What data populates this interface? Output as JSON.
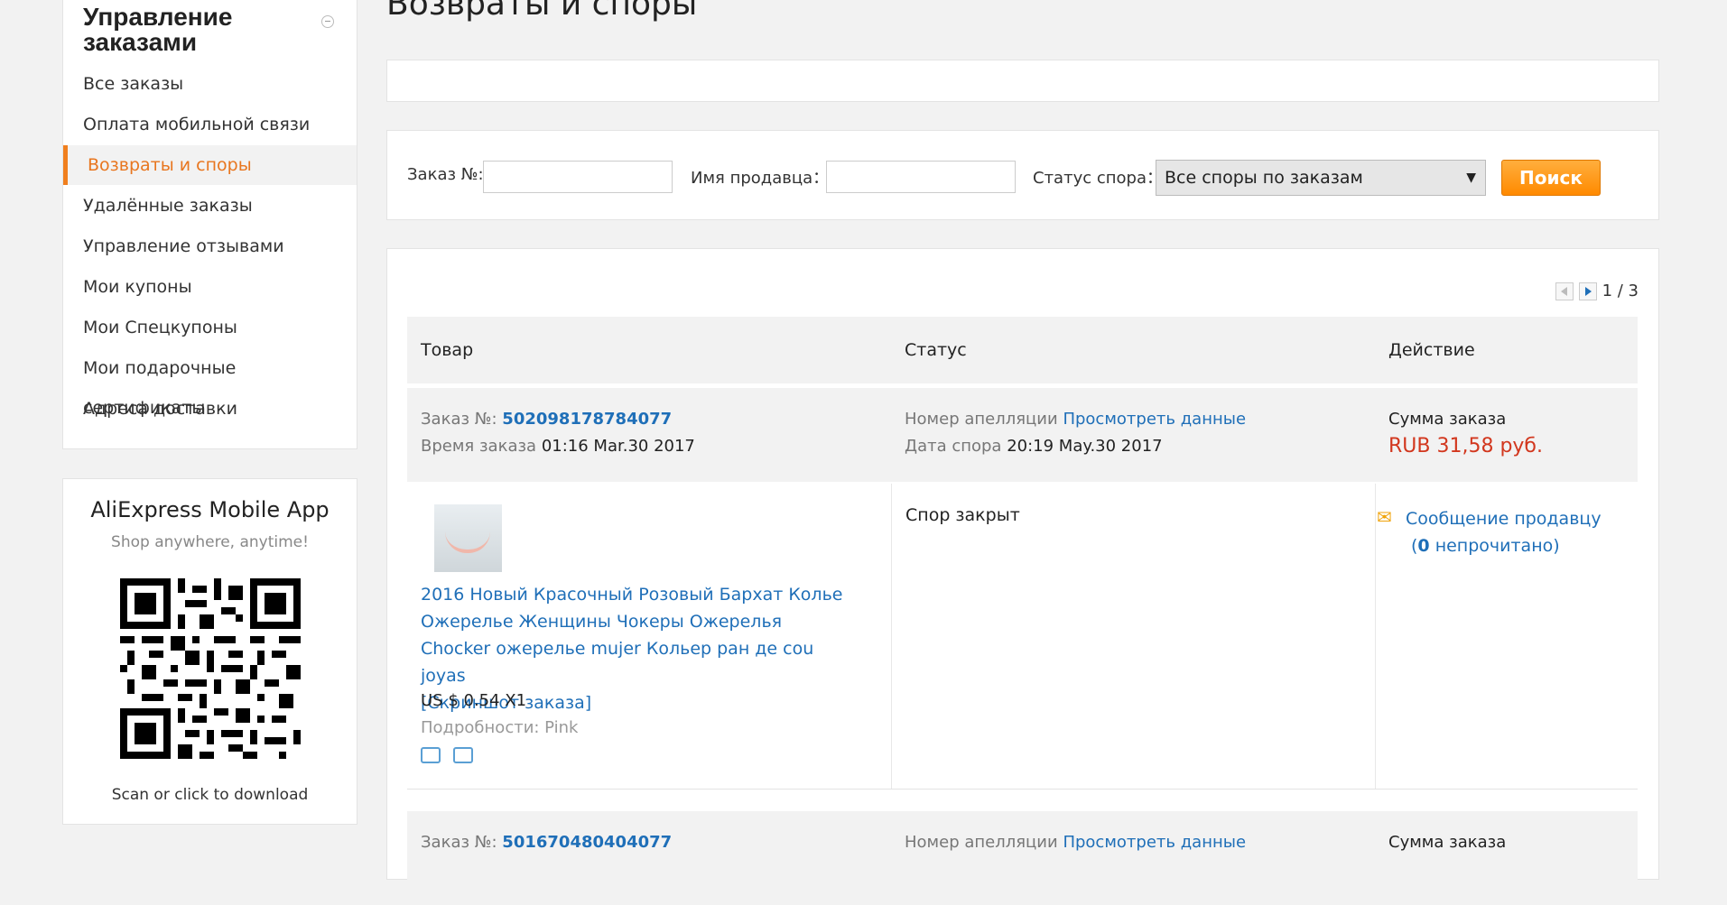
{
  "sidebar": {
    "title": "Управление заказами",
    "items": [
      {
        "label": "Все заказы"
      },
      {
        "label": "Оплата мобильной связи"
      },
      {
        "label": "Возвраты и споры"
      },
      {
        "label": "Удалённые заказы"
      },
      {
        "label": "Управление отзывами"
      },
      {
        "label": "Мои купоны"
      },
      {
        "label": "Мои Спецкупоны"
      },
      {
        "label": "Мои подарочные сертификаты"
      },
      {
        "label": "Адреса доставки"
      }
    ],
    "active_index": 2
  },
  "app_promo": {
    "title": "AliExpress Mobile App",
    "subtitle": "Shop anywhere, anytime!",
    "download_text": "Scan or click to download"
  },
  "page": {
    "title": "Возвраты и споры"
  },
  "filter": {
    "order_label": "Заказ №:",
    "order_value": "",
    "seller_label": "Имя продавца：",
    "seller_value": "",
    "status_label": "Статус спора：",
    "status_selected": "Все споры по заказам",
    "search_button": "Поиск"
  },
  "pager": {
    "text": "1 / 3"
  },
  "table": {
    "headers": [
      "Товар",
      "Статус",
      "Действие"
    ]
  },
  "orders": [
    {
      "order_label": "Заказ №:",
      "order_number": "502098178784077",
      "time_label": "Время заказа",
      "time_value": "01:16 Mar.30 2017",
      "appeal_label": "Номер апелляции",
      "appeal_link": "Просмотреть данные",
      "dispute_date_label": "Дата спора",
      "dispute_date_value": "20:19 May.30 2017",
      "sum_label": "Сумма заказа",
      "sum_value": "RUB 31,58 руб.",
      "product_title": "2016 Новый Красочный Розовый Бархат Колье Ожерелье Женщины Чокеры Ожерелья Chocker ожерелье mujer Кольер ран де cou joyas",
      "snapshot": "[Скриншот заказа]",
      "price": "US $ 0.54 X1",
      "details": "Подробности: Pink",
      "status": "Спор закрыт",
      "message_link": "Сообщение продавцу",
      "unread_prefix": "(",
      "unread_count": "0",
      "unread_suffix": " непрочитано)"
    },
    {
      "order_label": "Заказ №:",
      "order_number": "501670480404077",
      "appeal_label": "Номер апелляции",
      "appeal_link": "Просмотреть данные",
      "sum_label": "Сумма заказа"
    }
  ],
  "icons": {
    "collapse": "minus-circle-icon",
    "message": "envelope-icon",
    "truck": "truck-icon",
    "return": "return-icon"
  },
  "colors": {
    "accent": "#f07f1e",
    "link": "#1f6fb8",
    "price": "#d2371e"
  }
}
